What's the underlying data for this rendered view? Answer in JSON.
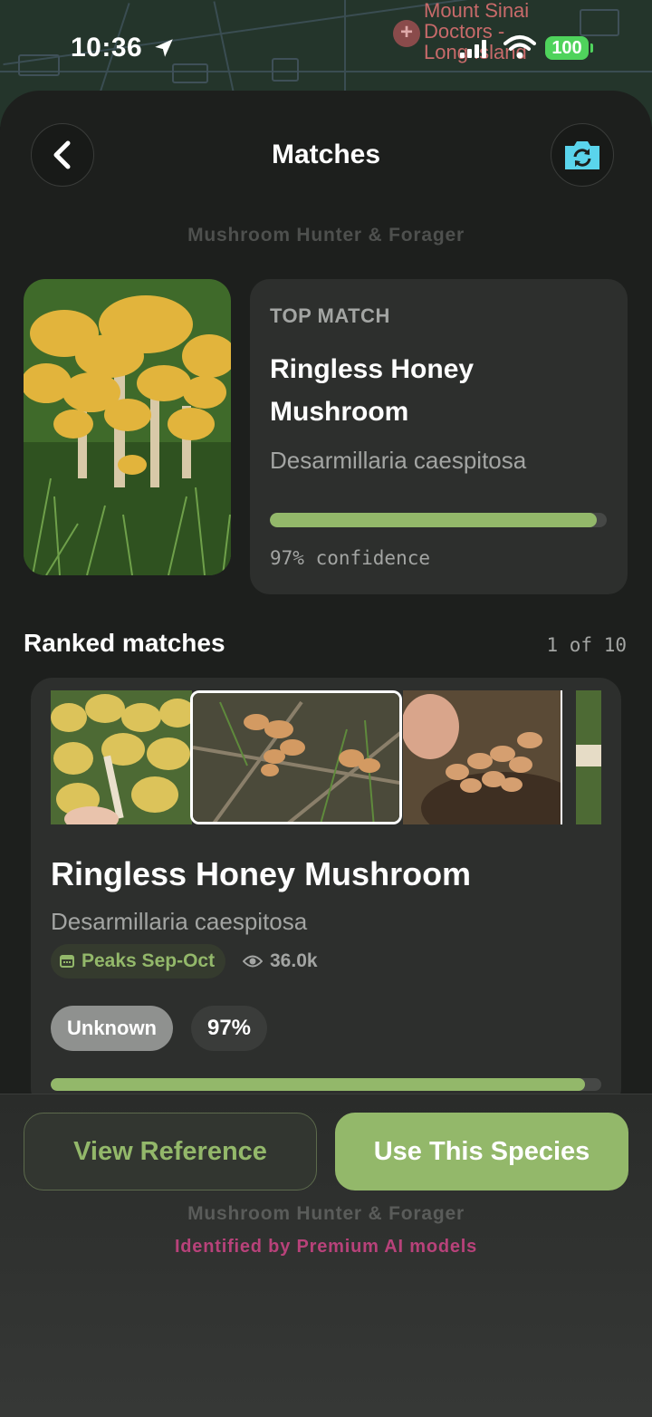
{
  "status_bar": {
    "time": "10:36",
    "battery": "100",
    "map_label_line1": "Mount Sinai",
    "map_label_line2": "Doctors -",
    "map_label_line3": "Long Island"
  },
  "header": {
    "title": "Matches",
    "back_icon": "chevron-left-icon",
    "camera_icon": "camera-rotate-icon",
    "camera_color": "#5ad4ec"
  },
  "app_name": "Mushroom Hunter & Forager",
  "top_match": {
    "tag": "TOP MATCH",
    "common_name": "Ringless Honey Mushroom",
    "scientific_name": "Desarmillaria caespitosa",
    "confidence_fraction": 0.97,
    "confidence_label": "97% confidence"
  },
  "ranked": {
    "title": "Ranked matches",
    "position": "1 of 10",
    "card": {
      "common_name": "Ringless Honey Mushroom",
      "scientific_name": "Desarmillaria caespitosa",
      "season": "Peaks Sep-Oct",
      "views": "36.0k",
      "status": "Unknown",
      "percent": "97%",
      "confidence_fraction": 0.97
    },
    "pages": 10,
    "active_page": 0
  },
  "actions": {
    "view_reference": "View Reference",
    "use_species": "Use This Species"
  },
  "footer": {
    "brand": "Mushroom Hunter & Forager",
    "powered_by": "Identified by Premium AI models"
  },
  "colors": {
    "accent": "#93b86a",
    "background": "#1d1f1d",
    "card": "#2d2f2d",
    "ai_text": "#b8427a"
  }
}
